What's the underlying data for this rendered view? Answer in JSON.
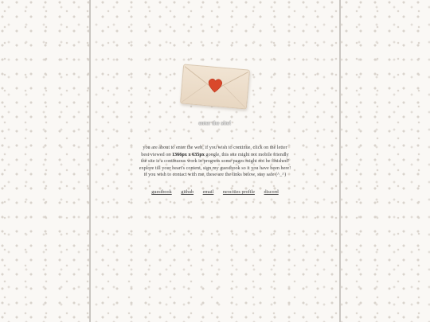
{
  "enter_label": "enter the site!",
  "message": {
    "line1": "you are about to enter the web, if you wish to continue, click on the letter",
    "line2_prefix": "best viewed on",
    "line2_bold": "1366px x 635px",
    "line2_suffix": "google, this site might not mobile friendly",
    "line3": "the site is a continuous work in progress some pages might not be finished!",
    "line4": "explore till your heart's content, sign my guestbook so it you have been here!",
    "line5": "if you wish to contact with me, these are the links below, stay safe (^_^)"
  },
  "links": [
    "guestbook",
    "github",
    "email",
    "neocities profile",
    "discord"
  ],
  "colors": {
    "heart": "#d9482b",
    "envelope": "#efe1cf",
    "rail": "#c9c5c0"
  },
  "icons": {
    "envelope": "envelope-icon",
    "heart": "heart-seal-icon"
  }
}
